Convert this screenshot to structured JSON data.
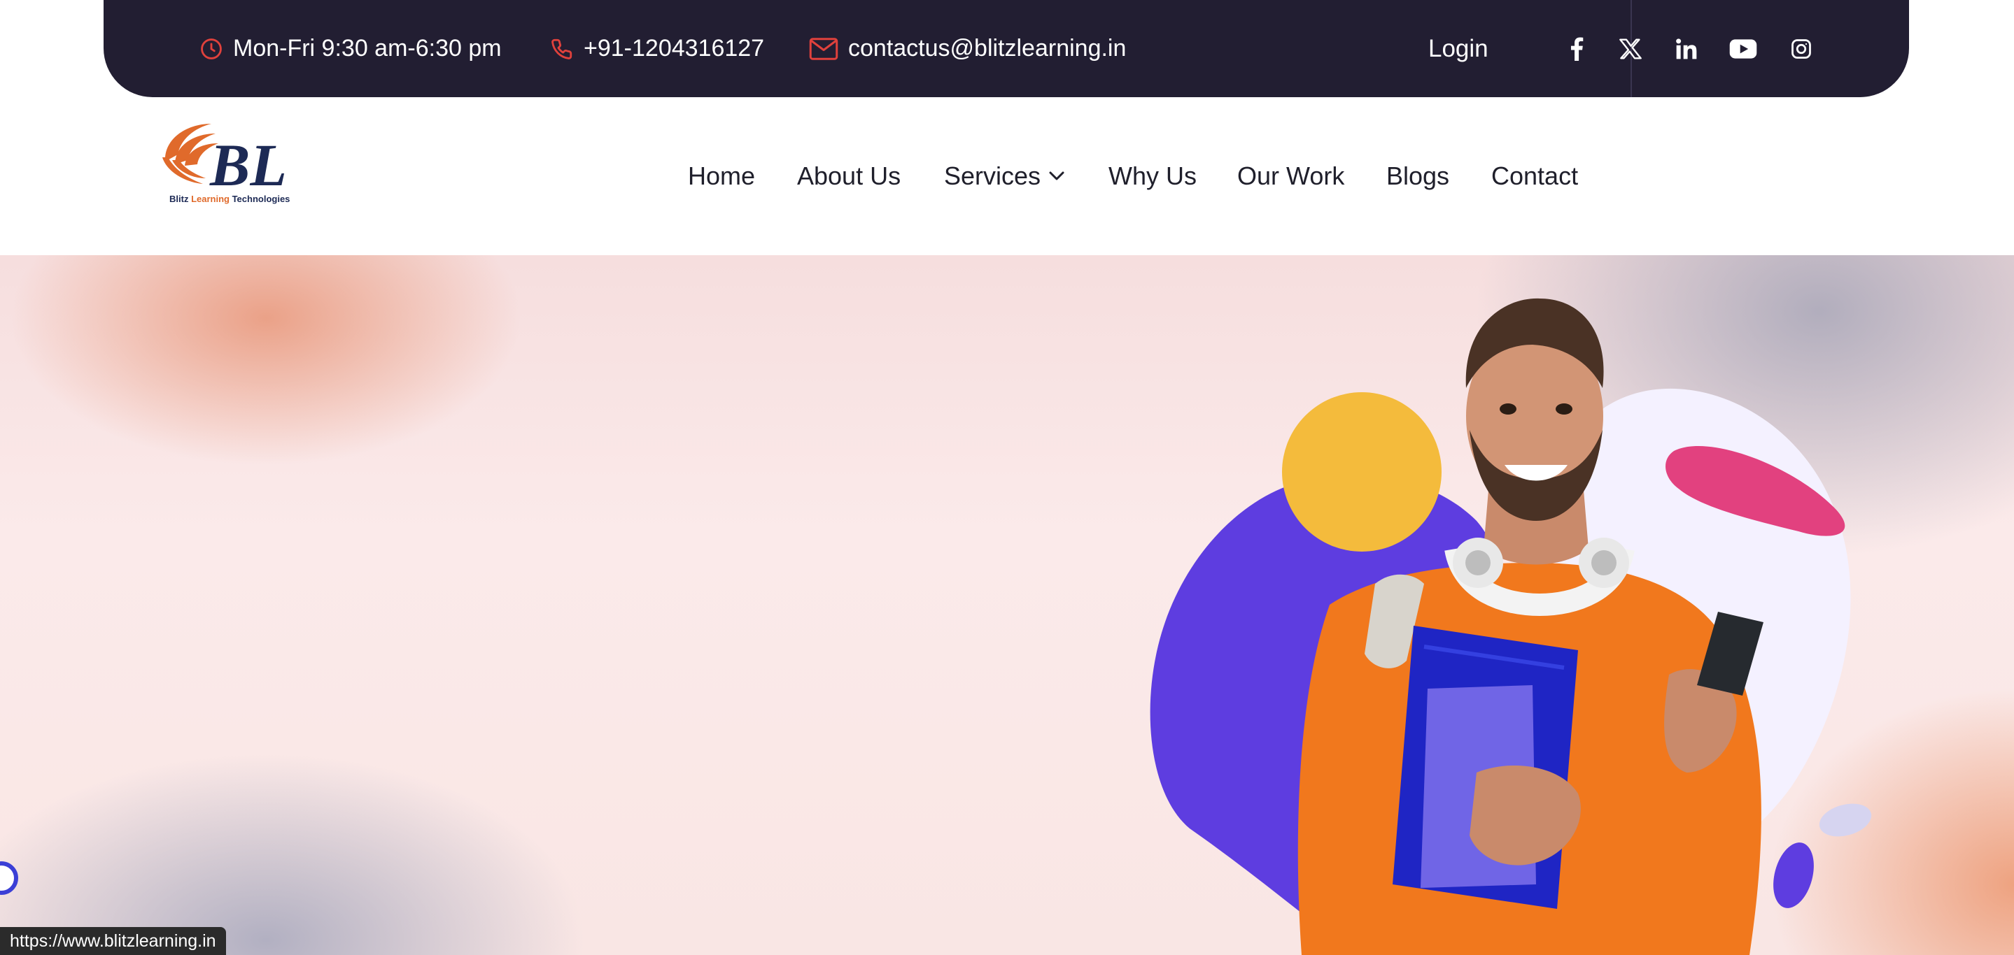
{
  "topbar": {
    "hours": "Mon-Fri 9:30 am-6:30 pm",
    "phone": "+91-1204316127",
    "email": "contactus@blitzlearning.in",
    "login_label": "Login",
    "icons": [
      "clock-icon",
      "phone-icon",
      "mail-icon"
    ],
    "social": [
      "facebook-icon",
      "x-icon",
      "linkedin-icon",
      "youtube-icon",
      "instagram-icon"
    ]
  },
  "logo": {
    "monogram": "BL",
    "caption_part1": "Blitz ",
    "caption_part2": "Learning",
    "caption_part3": " Technologies"
  },
  "nav": {
    "items": [
      "Home",
      "About Us",
      "Services",
      "Why Us",
      "Our Work",
      "Blogs",
      "Contact"
    ]
  },
  "status": {
    "url": "https://www.blitzlearning.in"
  },
  "colors": {
    "topbar_bg": "#221e32",
    "accent_red": "#e0413c",
    "logo_orange": "#e06a2b",
    "logo_navy": "#1d2a55",
    "blob_purple": "#5e3de0",
    "blob_yellow": "#f4bb3c",
    "blob_pink": "#e2417f",
    "sweater_orange": "#f1781d"
  }
}
